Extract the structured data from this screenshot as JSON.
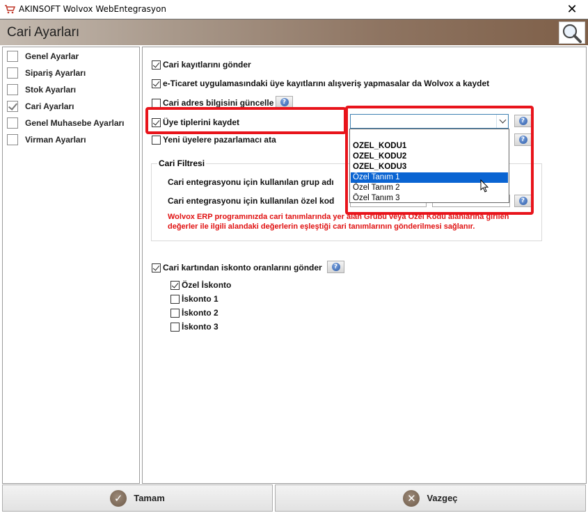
{
  "window": {
    "title": "AKINSOFT Wolvox WebEntegrasyon",
    "close_glyph": "✕"
  },
  "header": {
    "page_title": "Cari Ayarları",
    "search_icon": "magnifier-icon"
  },
  "sidebar": {
    "items": [
      {
        "label": "Genel Ayarlar",
        "checked": false
      },
      {
        "label": "Sipariş Ayarları",
        "checked": false
      },
      {
        "label": "Stok Ayarları",
        "checked": false
      },
      {
        "label": "Cari Ayarları",
        "checked": true
      },
      {
        "label": "Genel Muhasebe Ayarları",
        "checked": false
      },
      {
        "label": "Virman Ayarları",
        "checked": false
      }
    ]
  },
  "options": {
    "send_accounts": {
      "label": "Cari kayıtlarını gönder",
      "checked": true
    },
    "save_members": {
      "label": "e-Ticaret uygulamasındaki üye kayıtlarını alışveriş yapmasalar da Wolvox a kaydet",
      "checked": true
    },
    "update_address": {
      "label": "Cari adres bilgisini güncelle",
      "checked": false
    },
    "save_member_types": {
      "label": "Üye tiplerini kaydet",
      "checked": true
    },
    "new_member_seller": {
      "label": "Yeni üyelere pazarlamacı ata",
      "checked": false
    }
  },
  "member_type_combo": {
    "value": "",
    "options": [
      "OZEL_KODU1",
      "OZEL_KODU2",
      "OZEL_KODU3",
      "Özel Tanım 1",
      "Özel Tanım 2",
      "Özel Tanım 3"
    ],
    "highlighted": "Özel Tanım 1"
  },
  "filter": {
    "legend": "Cari Filtresi",
    "group_label": "Cari entegrasyonu için kullanılan grup adı",
    "special_code_label": "Cari entegrasyonu için kullanılan özel kod",
    "warning_line1": "Wolvox ERP programınızda cari tanımlarında yer alan Grubu veya Özel Kodu alanlarına girilen",
    "warning_line2": "değerler ile ilgili alandaki değerlerin eşleştiği cari tanımlarının gönderilmesi sağlanır."
  },
  "discount": {
    "label": "Cari kartından iskonto oranlarını gönder",
    "checked": true,
    "items": [
      {
        "label": "Özel İskonto",
        "checked": true
      },
      {
        "label": "İskonto 1",
        "checked": false
      },
      {
        "label": "İskonto 2",
        "checked": false
      },
      {
        "label": "İskonto 3",
        "checked": false
      }
    ]
  },
  "buttons": {
    "ok": "Tamam",
    "cancel": "Vazgeç"
  },
  "help_glyph": "?",
  "colors": {
    "highlight_red": "#e8141b",
    "selection_blue": "#0a64d2",
    "warning_red": "#e01010"
  }
}
